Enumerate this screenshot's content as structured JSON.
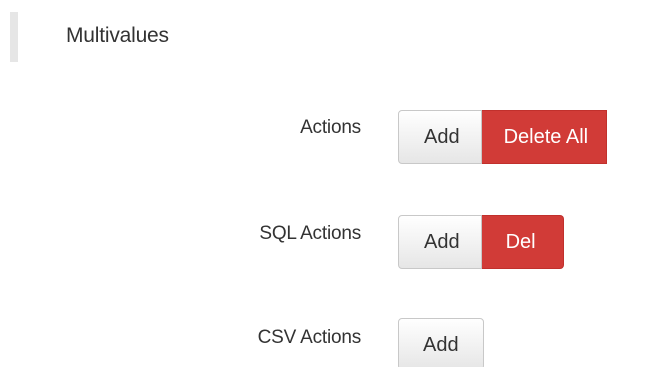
{
  "section": {
    "title": "Multivalues"
  },
  "rows": [
    {
      "label": "Actions",
      "add_label": "Add",
      "delete_label": "Delete All"
    },
    {
      "label": "SQL Actions",
      "add_label": "Add",
      "delete_label": "Del"
    },
    {
      "label": "CSV Actions",
      "add_label": "Add"
    }
  ],
  "colors": {
    "danger": "#d13b37",
    "section_bar": "#e6e6e6"
  }
}
